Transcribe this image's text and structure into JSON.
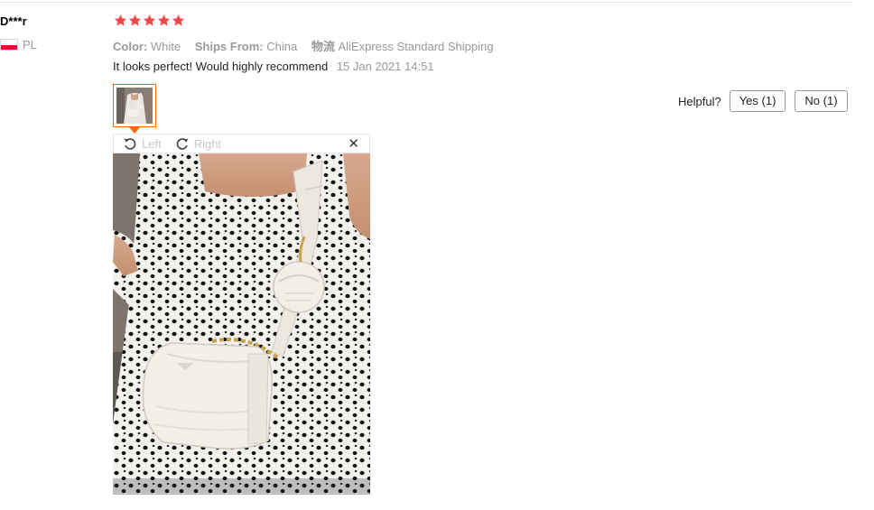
{
  "review": {
    "user_name": "D***r",
    "country_code": "PL",
    "rating": 5,
    "rating_color": "#f04848",
    "color_label": "Color:",
    "color_value": "White",
    "ships_label": "Ships From:",
    "ships_value": "China",
    "logistics_label": "物流",
    "logistics_value": "AliExpress Standard Shipping",
    "text": "It looks perfect! Would highly recommend",
    "date": "15 Jan 2021 14:51"
  },
  "helpful": {
    "label": "Helpful?",
    "yes_label": "Yes (1)",
    "no_label": "No (1)"
  },
  "viewer": {
    "rotate_left_label": "Left",
    "rotate_right_label": "Right",
    "close_glyph": "✕"
  },
  "colors": {
    "accent": "#ff6a00",
    "flag_red": "#dc143c"
  }
}
